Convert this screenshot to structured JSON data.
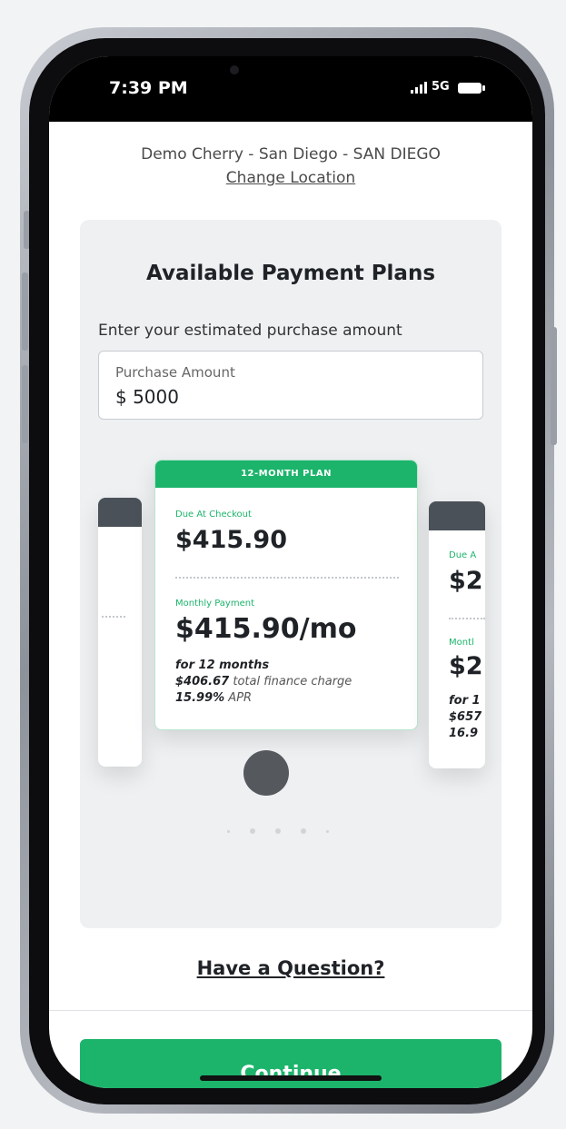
{
  "status_bar": {
    "time": "7:39 PM",
    "network": "5G"
  },
  "location": {
    "name": "Demo Cherry - San Diego - SAN DIEGO",
    "change_link": "Change Location"
  },
  "panel": {
    "title": "Available Payment Plans",
    "prompt": "Enter your estimated purchase amount",
    "amount_field": {
      "placeholder": "Purchase Amount",
      "value": "$ 5000"
    }
  },
  "plans": {
    "current": {
      "header": "12-MONTH PLAN",
      "due_label": "Due At Checkout",
      "due_amount": "$415.90",
      "monthly_label": "Monthly Payment",
      "monthly_amount": "$415.90/mo",
      "term": "for 12 months",
      "finance_value": "$406.67",
      "finance_text": "total finance charge",
      "apr_value": "15.99%",
      "apr_text": "APR"
    },
    "next_partial": {
      "due_label": "Due A",
      "due_amount": "$2",
      "monthly_label": "Montl",
      "monthly_amount": "$2",
      "term": "for 1",
      "finance": "$657",
      "apr": "16.9"
    },
    "page_count": 5,
    "active_page": 2
  },
  "help_link": "Have a Question?",
  "continue_button": "Continue",
  "colors": {
    "accent": "#1cb46b",
    "stub_header": "#4b5158",
    "panel_bg": "#eef0f2"
  }
}
